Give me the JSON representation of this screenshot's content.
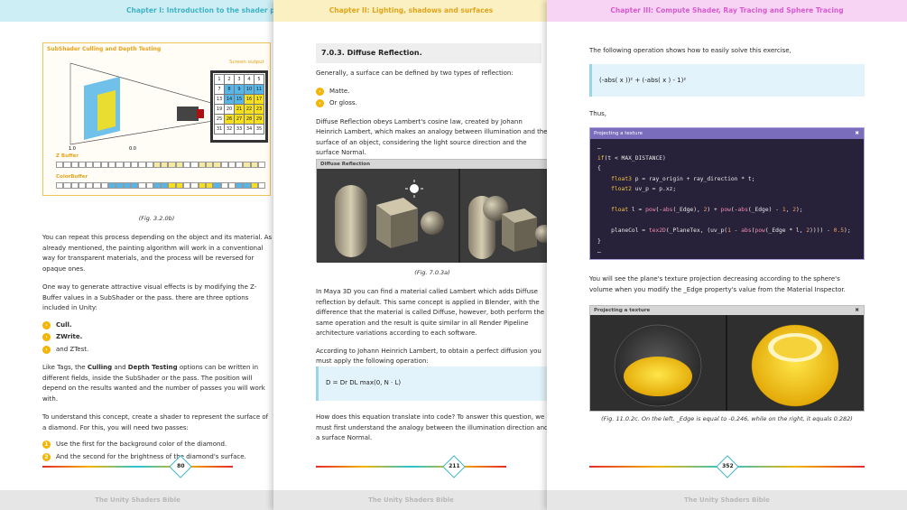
{
  "pages": [
    {
      "header": "Chapter I: Introduction to the shader programming",
      "figure": {
        "title": "SubShader Culling and Depth Testing",
        "screen_label": "Screen output",
        "grid": [
          [
            "1",
            "2",
            "3",
            "4",
            "5"
          ],
          [
            "7",
            "8",
            "9",
            "10",
            "11"
          ],
          [
            "13",
            "14",
            "15",
            "16",
            "17"
          ],
          [
            "19",
            "20",
            "21",
            "22",
            "23"
          ],
          [
            "25",
            "26",
            "27",
            "28",
            "29"
          ],
          [
            "31",
            "32",
            "33",
            "34",
            "35"
          ]
        ],
        "axis_left": "1.0",
        "axis_right": "0.0",
        "zbuffer_label": "Z Buffer",
        "colorbuffer_label": "ColorBuffer"
      },
      "caption": "(Fig. 3.2.0b)",
      "p1": "You can repeat this process depending on the object and its material. As already mentioned, the painting algorithm will work in a conventional way for transparent materials, and the process will be reversed for opaque ones.",
      "p2": "One way to generate attractive visual effects is by modifying the Z-Buffer values in a SubShader or the pass. there are three options included in Unity:",
      "bullets": [
        "Cull.",
        "ZWrite.",
        "and ZTest."
      ],
      "p3a": "Like Tags, the ",
      "p3b": "Culling",
      "p3c": " and ",
      "p3d": "Depth Testing",
      "p3e": " options can be written in different fields, inside the SubShader or the pass. The position will depend on the results wanted and the number of passes you will work with.",
      "p4": "To understand this concept, create a shader to represent the surface of a diamond. For this, you will need two passes:",
      "numbered": [
        [
          "1",
          "Use the first for the background color of the diamond."
        ],
        [
          "2",
          "And the second for the brightness of the diamond's surface."
        ]
      ],
      "page_number": "80",
      "footer": "The Unity Shaders Bible"
    },
    {
      "header": "Chapter II: Lighting, shadows and surfaces",
      "section_title": "7.0.3. Diffuse Reflection.",
      "p1": "Generally, a surface can be defined by two types of reflection:",
      "bullets": [
        "Matte.",
        "Or gloss."
      ],
      "p2": "Diffuse Reflection obeys Lambert's cosine law, created by Johann Heinrich Lambert, which makes an analogy between illumination and the surface of an object, considering the light source direction and the surface Normal.",
      "figure_title": "Diffuse Reflection",
      "caption": "(Fig. 7.0.3a)",
      "p3": "In Maya 3D you can find a material called Lambert which adds Diffuse reflection by default. This same concept is applied in Blender, with the difference that the material is called Diffuse, however, both perform the same operation and the result is quite similar in all Render Pipeline architecture variations according to each software.",
      "p4": "According to Johann Heinrich Lambert, to obtain a perfect diffusion you must apply the following operation:",
      "formula": "D = Dr  DL  max(0, N · L)",
      "p5": "How does this equation translate into code? To answer this question, we must first understand the analogy between the illumination direction and a surface Normal.",
      "page_number": "211",
      "footer": "The Unity Shaders Bible"
    },
    {
      "header": "Chapter III: Compute Shader, Ray Tracing and Sphere Tracing",
      "p1": "The following operation shows how to easily solve this exercise,",
      "formula": "(-abs( x ))² + (-abs( x ) - 1)²",
      "p2": "Thus,",
      "code_title": "Projecting a texture",
      "code_lines": [
        "…",
        "if(t < MAX_DISTANCE)",
        "{",
        "    float3 p = ray_origin + ray_direction * t;",
        "    float2 uv_p = p.xz;",
        "",
        "    float l = pow(-abs(_Edge), 2) + pow(-abs(_Edge) - 1, 2);",
        "",
        "    planeCol = tex2D(_PlaneTex, (uv_p(1 - abs(pow(_Edge * l, 2)))) - 0.5);",
        "}",
        "…"
      ],
      "p3": "You will see the plane's texture projection decreasing according to the sphere's volume when you modify the _Edge property's value from the Material Inspector.",
      "proj_title": "Projecting a texture",
      "caption": "(Fig. 11.0.2c. On the left, _Edge is equal to -0.246, while on the right, it equals 0.282)",
      "page_number": "352",
      "footer": "The Unity Shaders Bible"
    }
  ],
  "colors": {
    "accent_yellow": "#f4b400",
    "cyan": "#3fb3c6",
    "magenta": "#d65bcf"
  }
}
